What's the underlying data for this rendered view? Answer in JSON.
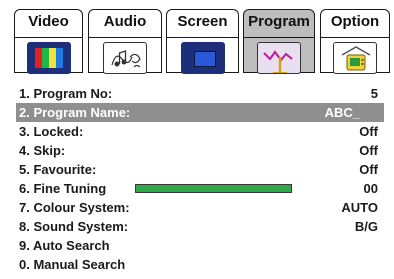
{
  "tabs": [
    {
      "label": "Video",
      "icon": "color-bars-icon",
      "active": false
    },
    {
      "label": "Audio",
      "icon": "music-notes-icon",
      "active": false
    },
    {
      "label": "Screen",
      "icon": "screen-icon",
      "active": false
    },
    {
      "label": "Program",
      "icon": "antenna-signal-icon",
      "active": true
    },
    {
      "label": "Option",
      "icon": "tv-settings-icon",
      "active": false
    }
  ],
  "menu": {
    "items": [
      {
        "label": "1. Program No:",
        "value": "5"
      },
      {
        "label": "2. Program Name:",
        "value": "ABC_",
        "selected": true
      },
      {
        "label": "3. Locked:",
        "value": "Off"
      },
      {
        "label": "4. Skip:",
        "value": "Off"
      },
      {
        "label": "5. Favourite:",
        "value": "Off"
      },
      {
        "label": "6. Fine Tuning",
        "value": "00",
        "bar_fill_fraction": 1.0
      },
      {
        "label": "7. Colour System:",
        "value": "AUTO"
      },
      {
        "label": "8. Sound System:",
        "value": "B/G"
      },
      {
        "label": "9. Auto Search",
        "value": ""
      },
      {
        "label": "0. Manual Search",
        "value": ""
      }
    ]
  },
  "colors": {
    "active_tab": "#bdbdbd",
    "highlight_row": "#8f8f8f",
    "fine_tuning_bar": "#2fa84a",
    "icon_background": "#1d2f7a"
  }
}
